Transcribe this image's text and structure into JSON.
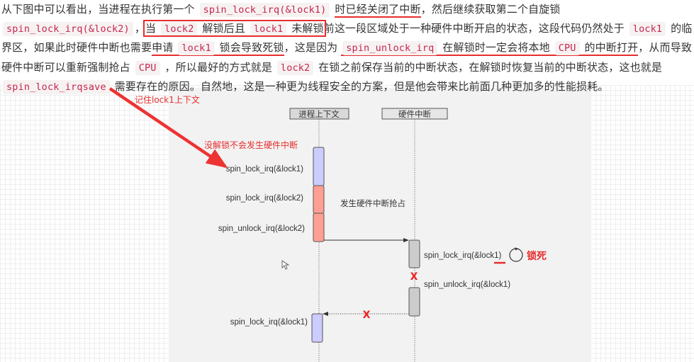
{
  "paragraph": {
    "segments": [
      {
        "t": "text",
        "v": "从下图中可以看出，当进程在执行第一个 "
      },
      {
        "t": "code",
        "v": "spin_lock_irq(&lock1)"
      },
      {
        "t": "text",
        "v": " "
      },
      {
        "t": "ul",
        "v": "时已经关闭了中断"
      },
      {
        "t": "text",
        "v": "，然后继续获取第二个自旋锁 "
      },
      {
        "t": "code",
        "v": "spin_lock_irq(&lock2)"
      },
      {
        "t": "text",
        "v": "，"
      },
      {
        "t": "boxstart"
      },
      {
        "t": "text",
        "v": "当 "
      },
      {
        "t": "code",
        "v": "lock2"
      },
      {
        "t": "text",
        "v": " 解锁后且 "
      },
      {
        "t": "code",
        "v": "lock1"
      },
      {
        "t": "text",
        "v": " 未解锁"
      },
      {
        "t": "boxend"
      },
      {
        "t": "text",
        "v": "前这一段区域处于一种硬件中断开启的状态，这段代码仍然处于 "
      },
      {
        "t": "code",
        "v": "lock1"
      },
      {
        "t": "text",
        "v": " 的临界区，如果此时硬件中断也需要"
      },
      {
        "t": "ulstart"
      },
      {
        "t": "text",
        "v": "申请 "
      },
      {
        "t": "code",
        "v": "lock1"
      },
      {
        "t": "text",
        "v": " 锁会导致死锁"
      },
      {
        "t": "ulend"
      },
      {
        "t": "text",
        "v": "，这是因为 "
      },
      {
        "t": "ulstart"
      },
      {
        "t": "code",
        "v": "spin_unlock_irq"
      },
      {
        "t": "text",
        "v": " 在解锁时一定会将本地 "
      },
      {
        "t": "code",
        "v": "CPU"
      },
      {
        "t": "text",
        "v": " 的中断打开"
      },
      {
        "t": "ulend"
      },
      {
        "t": "text",
        "v": "，从而导致硬件中断可以重新强制抢占 "
      },
      {
        "t": "code",
        "v": "CPU"
      },
      {
        "t": "text",
        "v": " ，所以最好的方式就是 "
      },
      {
        "t": "code",
        "v": "lock2"
      },
      {
        "t": "text",
        "v": " 在锁之前保存当前的中断状态，在解锁时恢复当前的中断状态，这也就是 "
      },
      {
        "t": "code",
        "v": "spin_lock_irqsave"
      },
      {
        "t": "text",
        "v": " 需要存在的原因。自然地，这是一种更为线程安全的方案，但是他会带来比前面几种更加多的性能损耗。"
      }
    ]
  },
  "annotations": {
    "remember_context": "记住lock1上下文",
    "no_unlock_no_irq": "没解锁不会发生硬件中断",
    "irq_preempt": "发生硬件中断抢占",
    "deadlock": "锁死"
  },
  "diagram": {
    "lifelines": [
      {
        "name": "进程上下文"
      },
      {
        "name": "硬件中断"
      }
    ],
    "calls": {
      "process_lock1": "spin_lock_irq(&lock1)",
      "process_lock2": "spin_lock_irq(&lock2)",
      "process_unlock2": "spin_unlock_irq(&lock2)",
      "irq_lock1": "spin_lock_irq(&lock1)",
      "irq_unlock1": "spin_unlock_irq(&lock1)",
      "process_lock1_again": "spin_lock_irq(&lock1)"
    },
    "cross_mark": "X"
  },
  "colors": {
    "accent_red": "#e62e2e",
    "code_red": "#c7254e",
    "activation_blue": "#ccccff",
    "activation_red": "#ff9f94",
    "activation_gray": "#cccccc"
  }
}
